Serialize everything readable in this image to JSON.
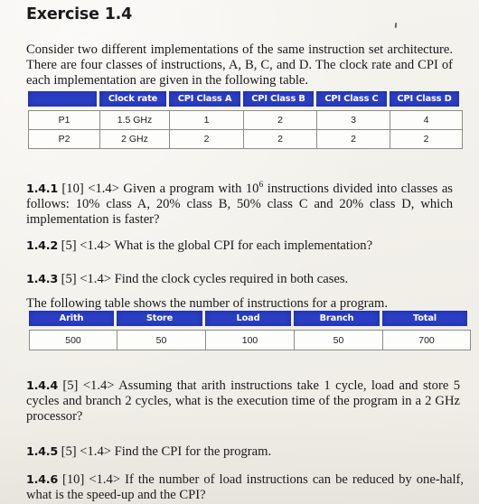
{
  "page": {
    "title": "Exercise 1.4",
    "intro": "Consider two different implementations of the same instruction set architecture. There are four classes of instructions, A, B, C, and D. The clock rate and CPI of each implementation are given in the following table.",
    "table_caption": "The following table shows the number of instructions for a program."
  },
  "table_cpi": {
    "headers": [
      "",
      "Clock rate",
      "CPI Class A",
      "CPI Class B",
      "CPI Class C",
      "CPI Class D"
    ],
    "rows": [
      [
        "P1",
        "1.5 GHz",
        "1",
        "2",
        "3",
        "4"
      ],
      [
        "P2",
        "2 GHz",
        "2",
        "2",
        "2",
        "2"
      ]
    ]
  },
  "table_instructions": {
    "headers": [
      "Arith",
      "Store",
      "Load",
      "Branch",
      "Total"
    ],
    "rows": [
      [
        "500",
        "50",
        "100",
        "50",
        "700"
      ]
    ]
  },
  "questions": [
    {
      "id": "1.4.1",
      "points": "[10]",
      "section": "<1.4>",
      "text_before_sup": "Given a program with 10",
      "sup": "6",
      "text_after_sup": " instructions divided into classes as follows: 10% class A, 20% class B, 50% class C and 20% class D, which implementation is faster?"
    },
    {
      "id": "1.4.2",
      "points": "[5]",
      "section": "<1.4>",
      "text": "What is the global CPI for each implementation?"
    },
    {
      "id": "1.4.3",
      "points": "[5]",
      "section": "<1.4>",
      "text": "Find the clock cycles required in both cases."
    },
    {
      "id": "1.4.4",
      "points": "[5]",
      "section": "<1.4>",
      "text": "Assuming that arith instructions take 1 cycle, load and store 5 cycles and branch 2 cycles, what is the execution time of the program in a 2 GHz processor?"
    },
    {
      "id": "1.4.5",
      "points": "[5]",
      "section": "<1.4>",
      "text": "Find the CPI for the program."
    },
    {
      "id": "1.4.6",
      "points": "[10]",
      "section": "<1.4>",
      "text": "If the number of load instructions can be reduced by one-half, what is the speed-up and the CPI?"
    }
  ],
  "colors": {
    "header_blue": "#2b3fc4",
    "page_background": "#f4f2ed",
    "text": "#17151a"
  }
}
